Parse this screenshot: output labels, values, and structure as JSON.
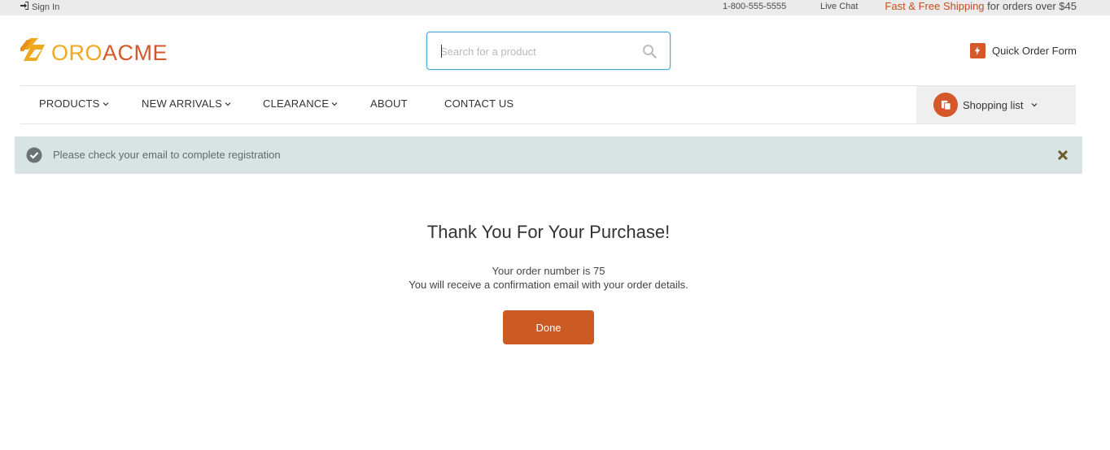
{
  "topbar": {
    "sign_in": "Sign In",
    "phone": "1-800-555-5555",
    "live_chat": "Live Chat",
    "shipping_highlight": "Fast & Free Shipping",
    "shipping_rest": " for orders over $45"
  },
  "logo": {
    "part1": "ORO",
    "part2": "ACME"
  },
  "search": {
    "placeholder": "Search for a product",
    "icon": "search-icon"
  },
  "quick_order": {
    "label": "Quick Order Form",
    "icon": "lightning-icon"
  },
  "nav": {
    "items": [
      {
        "label": "PRODUCTS",
        "dropdown": true
      },
      {
        "label": "NEW ARRIVALS",
        "dropdown": true
      },
      {
        "label": "CLEARANCE",
        "dropdown": true
      },
      {
        "label": "ABOUT",
        "dropdown": false
      },
      {
        "label": "CONTACT US",
        "dropdown": false
      }
    ],
    "shopping_list": "Shopping list"
  },
  "alert": {
    "message": "Please check your email to complete registration"
  },
  "confirmation": {
    "title": "Thank You For Your Purchase!",
    "order_line": "Your order number is 75",
    "email_line": "You will receive a confirmation email with your order details.",
    "done_label": "Done"
  },
  "colors": {
    "brand_orange": "#d4582a",
    "brand_yellow": "#f0a91f",
    "button": "#cb5a23",
    "alert_bg": "#d8e3e3",
    "search_focus": "#4aa3d8"
  }
}
